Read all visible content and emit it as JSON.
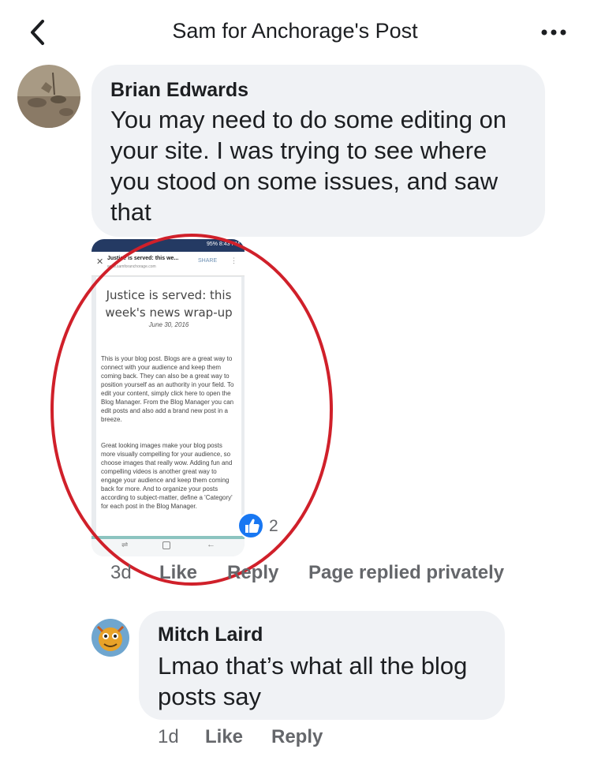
{
  "header": {
    "title": "Sam for Anchorage's Post"
  },
  "icons": {
    "back": "chevron-left-icon",
    "more": "more-horizontal-icon",
    "like": "thumbs-up-icon"
  },
  "comments": [
    {
      "author": "Brian Edwards",
      "text": "You may need to do some editing on your site. I was trying to see where you stood on some issues, and saw that",
      "lines": [
        "You may need to do some editing on",
        "your site. I was trying to see where",
        "you stood on some issues, and saw",
        "that"
      ],
      "time": "3d",
      "like_label": "Like",
      "reply_label": "Reply",
      "note": "Page replied privately",
      "reactions": {
        "count": "2"
      },
      "attachment": {
        "status": "95% 8:43 PM",
        "tab_title": "Justice is served: this we...",
        "url": "www.samforanchorage.com",
        "share_label": "SHARE",
        "post_title": "Justice is served: this week's news wrap-up",
        "post_title_lines": [
          "Justice is served: this",
          "week's news wrap-up"
        ],
        "post_date": "June 30, 2016",
        "paragraph1": "This is your blog post. Blogs are a great way to connect with your audience and keep them coming back. They can also be a great way to position yourself as an authority in your field. To edit your content, simply click here to open the Blog Manager. From the Blog Manager you can edit posts and also add a brand new post in a breeze.",
        "paragraph2": "Great looking images make your blog posts more visually compelling for your audience, so choose images that really wow. Adding fun and compelling videos is another great way to engage your audience and keep them coming back for more. And to organize your posts according to subject-matter, define a 'Category' for each post in the Blog Manager."
      }
    },
    {
      "author": "Mitch Laird",
      "text": "Lmao that's what all the blog posts say",
      "lines": [
        "Lmao that’s what all the blog",
        "posts say"
      ],
      "time": "1d",
      "like_label": "Like",
      "reply_label": "Reply"
    }
  ],
  "colors": {
    "annotation_circle": "#d0202a",
    "like_blue": "#1877f2",
    "bubble": "#f0f2f5",
    "meta_gray": "#65676b"
  }
}
